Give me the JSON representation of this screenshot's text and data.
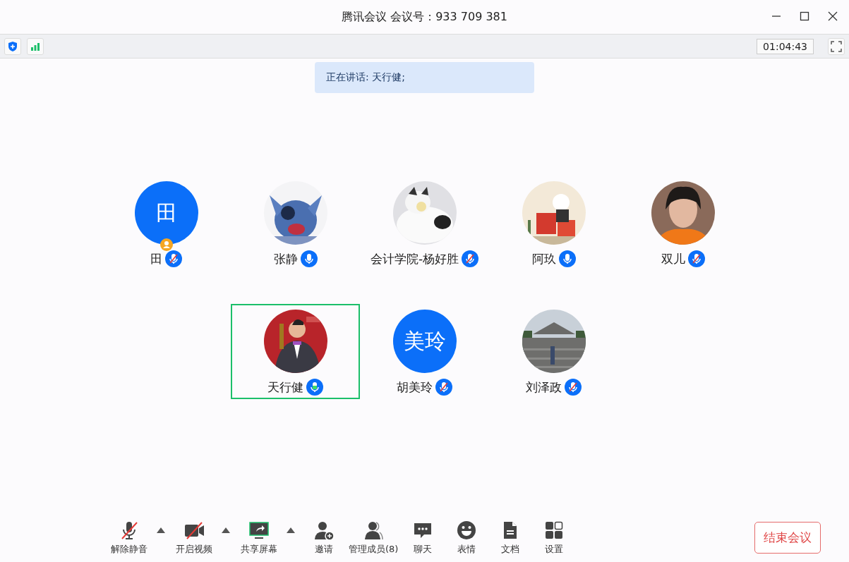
{
  "window": {
    "title": "腾讯会议 会议号：933 709 381"
  },
  "toolbar": {
    "timer": "01:04:43"
  },
  "speaking_banner": "正在讲话: 天行健;",
  "participants": [
    [
      {
        "name": "田",
        "avatar": {
          "kind": "initials",
          "text": "田"
        },
        "host": true,
        "muted": true,
        "selected": false
      },
      {
        "name": "张静",
        "host": false,
        "muted": false,
        "selected": false
      },
      {
        "name": "会计学院-杨好胜",
        "host": false,
        "muted": true,
        "selected": false
      },
      {
        "name": "阿玖",
        "host": false,
        "muted": false,
        "selected": false
      },
      {
        "name": "双儿",
        "host": false,
        "muted": true,
        "selected": false
      }
    ],
    [
      {
        "name": "天行健",
        "host": false,
        "muted": false,
        "speaking": true,
        "selected": true
      },
      {
        "name": "胡美玲",
        "avatar": {
          "kind": "initials",
          "text": "美玲"
        },
        "host": false,
        "muted": true,
        "selected": false
      },
      {
        "name": "刘泽政",
        "host": false,
        "muted": true,
        "selected": false
      }
    ]
  ],
  "controls": [
    {
      "kind": "mic",
      "label": "解除静音",
      "off": true,
      "has_menu": true
    },
    {
      "kind": "video",
      "label": "开启视频",
      "off": true,
      "has_menu": true
    },
    {
      "kind": "share",
      "label": "共享屏幕",
      "has_menu": true
    },
    {
      "kind": "invite",
      "label": "邀请"
    },
    {
      "kind": "members",
      "label": "管理成员(8)"
    },
    {
      "kind": "chat",
      "label": "聊天"
    },
    {
      "kind": "emoji",
      "label": "表情"
    },
    {
      "kind": "docs",
      "label": "文档"
    },
    {
      "kind": "settings",
      "label": "设置"
    }
  ],
  "end_button": "结束会议"
}
